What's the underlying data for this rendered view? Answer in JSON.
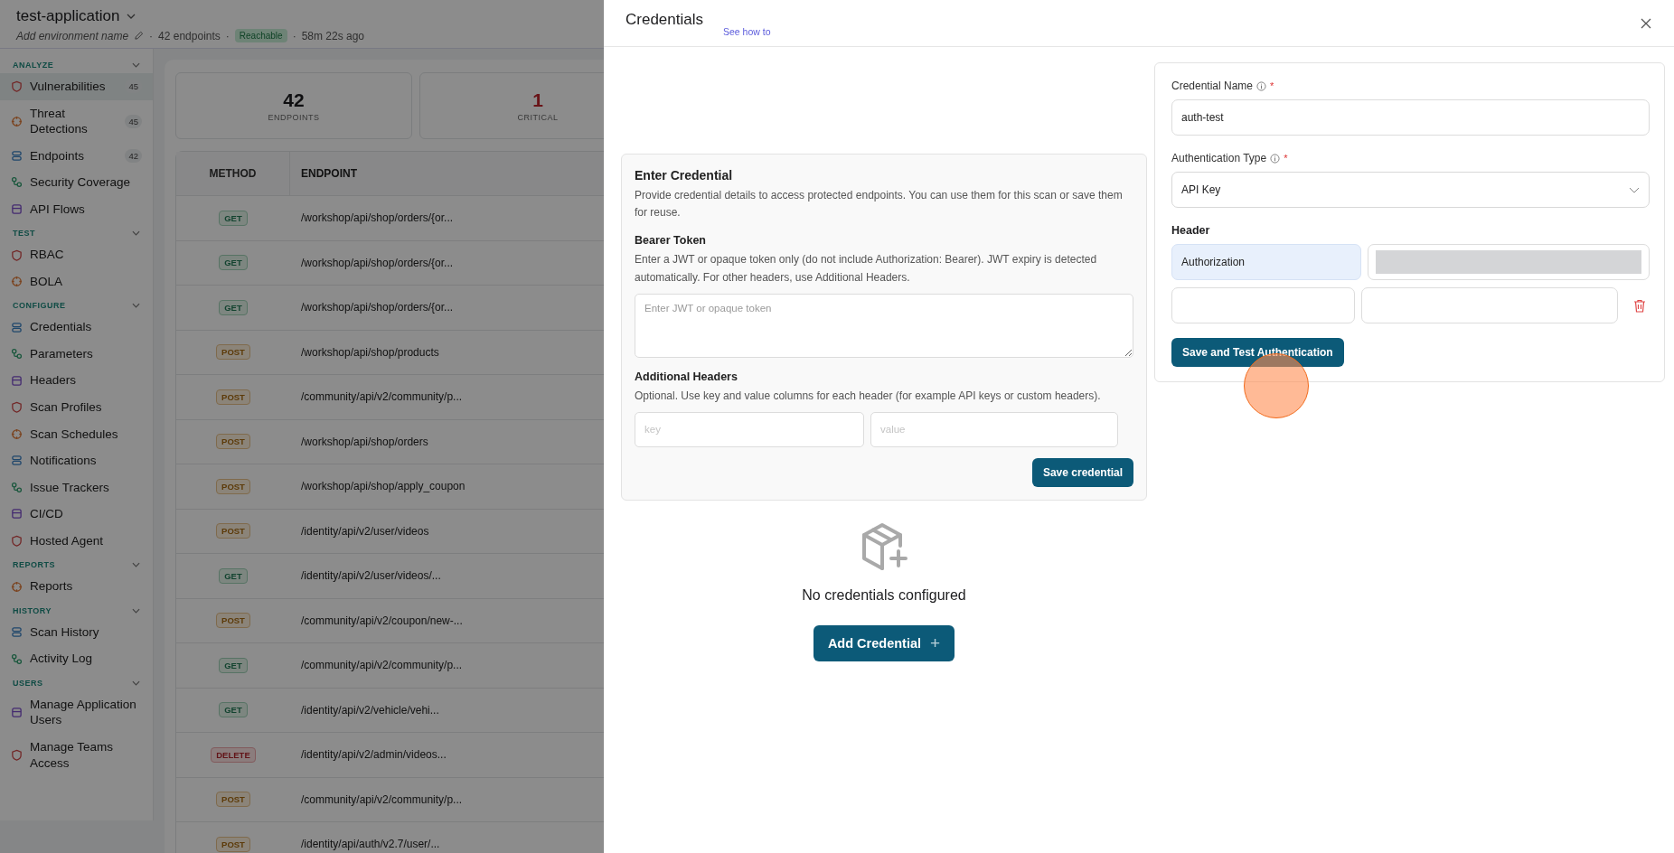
{
  "app": {
    "name": "test-application",
    "environment_placeholder": "Add environment name",
    "separator": "·",
    "endpoints": "42 endpoints",
    "status": "Reachable",
    "updated": "58m 22s ago"
  },
  "sidebar": {
    "sections": [
      {
        "title": "ANALYZE",
        "items": [
          {
            "label": "Vulnerabilities",
            "badge": "45",
            "selected": true
          },
          {
            "label": "Threat Detections",
            "badge": "45",
            "selected": false
          },
          {
            "label": "Endpoints",
            "badge": "42",
            "selected": false
          },
          {
            "label": "Security Coverage",
            "selected": false
          },
          {
            "label": "API Flows",
            "selected": false
          }
        ]
      },
      {
        "title": "TEST",
        "items": [
          {
            "label": "RBAC",
            "selected": false
          },
          {
            "label": "BOLA",
            "selected": false
          }
        ]
      },
      {
        "title": "CONFIGURE",
        "items": [
          {
            "label": "Credentials",
            "selected": false
          },
          {
            "label": "Parameters",
            "selected": false
          },
          {
            "label": "Headers",
            "selected": false
          },
          {
            "label": "Scan Profiles",
            "selected": false
          },
          {
            "label": "Scan Schedules",
            "selected": false
          },
          {
            "label": "Notifications",
            "selected": false
          },
          {
            "label": "Issue Trackers",
            "selected": false
          },
          {
            "label": "CI/CD",
            "selected": false
          },
          {
            "label": "Hosted Agent",
            "selected": false
          }
        ]
      },
      {
        "title": "REPORTS",
        "items": [
          {
            "label": "Reports",
            "selected": false
          }
        ]
      },
      {
        "title": "HISTORY",
        "items": [
          {
            "label": "Scan History",
            "selected": false
          },
          {
            "label": "Activity Log",
            "selected": false
          }
        ]
      },
      {
        "title": "USERS",
        "items": [
          {
            "label": "Manage Application Users",
            "selected": false
          },
          {
            "label": "Manage Teams Access",
            "selected": false
          }
        ]
      }
    ]
  },
  "stats": [
    {
      "value": "42",
      "label": "ENDPOINTS",
      "kind": "total"
    },
    {
      "value": "1",
      "label": "CRITICAL",
      "kind": "critical"
    }
  ],
  "table": {
    "columns": [
      "METHOD",
      "ENDPOINT"
    ],
    "rows": [
      {
        "method": "GET",
        "kind": "get",
        "endpoint": "/workshop/api/shop/orders/{or..."
      },
      {
        "method": "GET",
        "kind": "get",
        "endpoint": "/workshop/api/shop/orders/{or..."
      },
      {
        "method": "GET",
        "kind": "get",
        "endpoint": "/workshop/api/shop/orders/{or..."
      },
      {
        "method": "POST",
        "kind": "post",
        "endpoint": "/workshop/api/shop/products"
      },
      {
        "method": "POST",
        "kind": "post",
        "endpoint": "/community/api/v2/community/p..."
      },
      {
        "method": "POST",
        "kind": "post",
        "endpoint": "/workshop/api/shop/orders"
      },
      {
        "method": "POST",
        "kind": "post",
        "endpoint": "/workshop/api/shop/apply_coupon"
      },
      {
        "method": "POST",
        "kind": "post",
        "endpoint": "/identity/api/v2/user/videos"
      },
      {
        "method": "GET",
        "kind": "get",
        "endpoint": "/identity/api/v2/user/videos/..."
      },
      {
        "method": "POST",
        "kind": "post",
        "endpoint": "/community/api/v2/coupon/new-..."
      },
      {
        "method": "GET",
        "kind": "get",
        "endpoint": "/community/api/v2/community/p..."
      },
      {
        "method": "GET",
        "kind": "get",
        "endpoint": "/identity/api/v2/vehicle/vehi..."
      },
      {
        "method": "DELETE",
        "kind": "delete",
        "endpoint": "/identity/api/v2/admin/videos..."
      },
      {
        "method": "POST",
        "kind": "post",
        "endpoint": "/community/api/v2/community/p..."
      },
      {
        "method": "POST",
        "kind": "post",
        "endpoint": "/identity/api/auth/v2.7/user/..."
      }
    ]
  },
  "drawer": {
    "title": "Credentials",
    "help_link": "See how to",
    "enter_credential": {
      "title": "Enter Credential",
      "description": "Provide credential details to access protected endpoints. You can use them for this scan or save them for reuse.",
      "bearer_label": "Bearer Token",
      "bearer_description": "Enter a JWT or opaque token only (do not include Authorization: Bearer). JWT expiry is detected automatically. For other headers, use Additional Headers.",
      "bearer_placeholder": "Enter JWT or opaque token",
      "headers_label": "Additional Headers",
      "headers_description": "Optional. Use key and value columns for each header (for example API keys or custom headers).",
      "key_placeholder": "key",
      "value_placeholder": "value",
      "save_button": "Save credential"
    },
    "empty_state": {
      "message": "No credentials configured",
      "button": "Add Credential",
      "button_icon": "+"
    },
    "form": {
      "name_label": "Credential Name",
      "name_required": "*",
      "name_value": "auth-test",
      "type_label": "Authentication Type",
      "type_required": "*",
      "type_value": "API Key",
      "header_label": "Header",
      "headers": [
        {
          "key": "Authorization",
          "highlighted": true,
          "redacted": true,
          "removable": false
        },
        {
          "highlighted": false,
          "redacted": false,
          "removable": true
        }
      ],
      "submit_button": "Save and Test Authentication"
    }
  }
}
